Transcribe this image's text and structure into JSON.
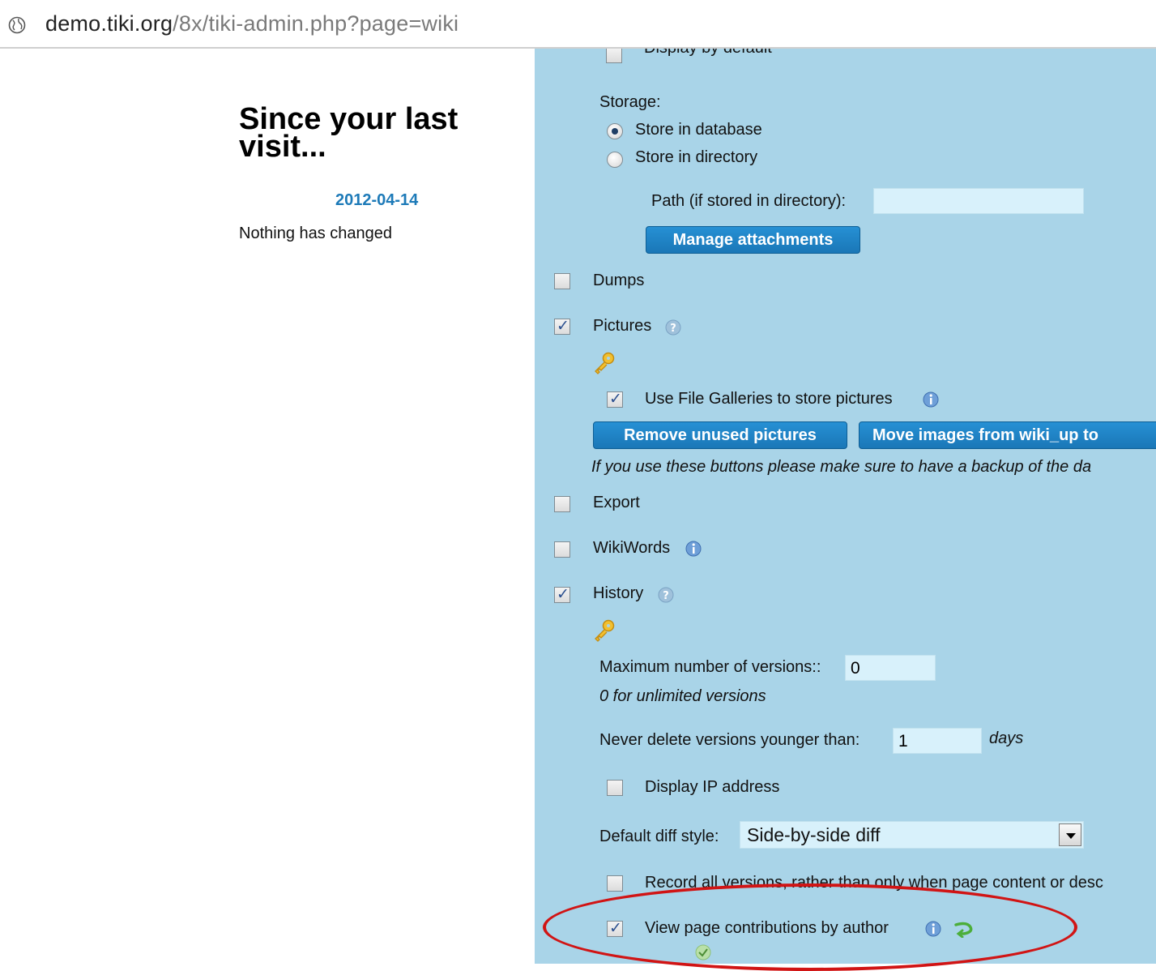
{
  "browser": {
    "url_host": "demo.tiki.org",
    "url_path": "/8x/tiki-admin.php?page=wiki"
  },
  "sidebar": {
    "title": "Since your last visit...",
    "date": "2012-04-14",
    "message": "Nothing has changed"
  },
  "panel": {
    "display_by_default": {
      "label": "Display by default",
      "checked": false
    },
    "storage_label": "Storage:",
    "storage_options": [
      {
        "label": "Store in database",
        "selected": true
      },
      {
        "label": "Store in directory",
        "selected": false
      }
    ],
    "path_label": "Path (if stored in directory):",
    "path_value": "",
    "manage_attachments": "Manage attachments",
    "dumps": {
      "label": "Dumps",
      "checked": false
    },
    "pictures": {
      "label": "Pictures",
      "checked": true
    },
    "file_galleries": {
      "label": "Use File Galleries to store pictures",
      "checked": true
    },
    "remove_unused": "Remove unused pictures",
    "move_images": "Move images from wiki_up to",
    "backup_note": "If you use these buttons please make sure to have a backup of the da",
    "export": {
      "label": "Export",
      "checked": false
    },
    "wikiwords": {
      "label": "WikiWords",
      "checked": false
    },
    "history": {
      "label": "History",
      "checked": true
    },
    "max_versions_label": "Maximum number of versions::",
    "max_versions_value": "0",
    "unlimited_note": "0 for unlimited versions",
    "never_delete_label": "Never delete versions younger than:",
    "never_delete_value": "1",
    "days_label": "days",
    "display_ip": {
      "label": "Display IP address",
      "checked": false
    },
    "diff_style_label": "Default diff style:",
    "diff_style_value": "Side-by-side diff",
    "record_all": {
      "label": "Record all versions, rather than only when page content or desc",
      "checked": false
    },
    "view_contributions": {
      "label": "View page contributions by author",
      "checked": true
    }
  },
  "colors": {
    "panel_bg": "#a9d4e8",
    "button_bg": "#1f84c6",
    "date_link": "#1d7ab8",
    "highlight_ellipse": "#d11414"
  }
}
